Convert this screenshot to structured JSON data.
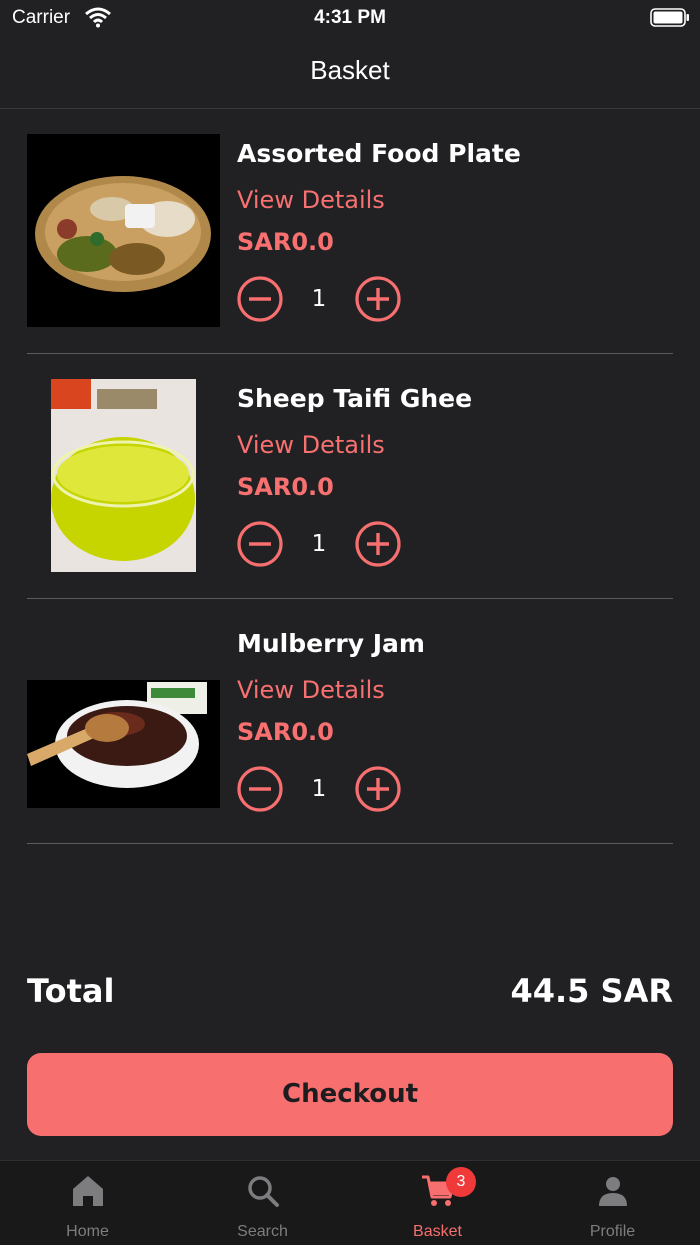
{
  "status_bar": {
    "carrier": "Carrier",
    "time": "4:31 PM"
  },
  "nav": {
    "title": "Basket"
  },
  "items": [
    {
      "name": "Assorted Food Plate",
      "details_label": "View Details",
      "price": "SAR0.0",
      "quantity": "1"
    },
    {
      "name": "Sheep Taifi Ghee",
      "details_label": "View Details",
      "price": "SAR0.0",
      "quantity": "1"
    },
    {
      "name": "Mulberry Jam",
      "details_label": "View Details",
      "price": "SAR0.0",
      "quantity": "1"
    }
  ],
  "summary": {
    "total_label": "Total",
    "total_value": "44.5 SAR"
  },
  "checkout_label": "Checkout",
  "tabs": [
    {
      "label": "Home",
      "icon": "home-icon"
    },
    {
      "label": "Search",
      "icon": "search-icon"
    },
    {
      "label": "Basket",
      "icon": "cart-icon",
      "badge": "3",
      "active": true
    },
    {
      "label": "Profile",
      "icon": "person-icon"
    }
  ],
  "colors": {
    "accent": "#f76f6f",
    "background": "#212124",
    "tab_bar": "#19191a",
    "badge": "#f03a3a",
    "inactive": "#7d7d80"
  }
}
